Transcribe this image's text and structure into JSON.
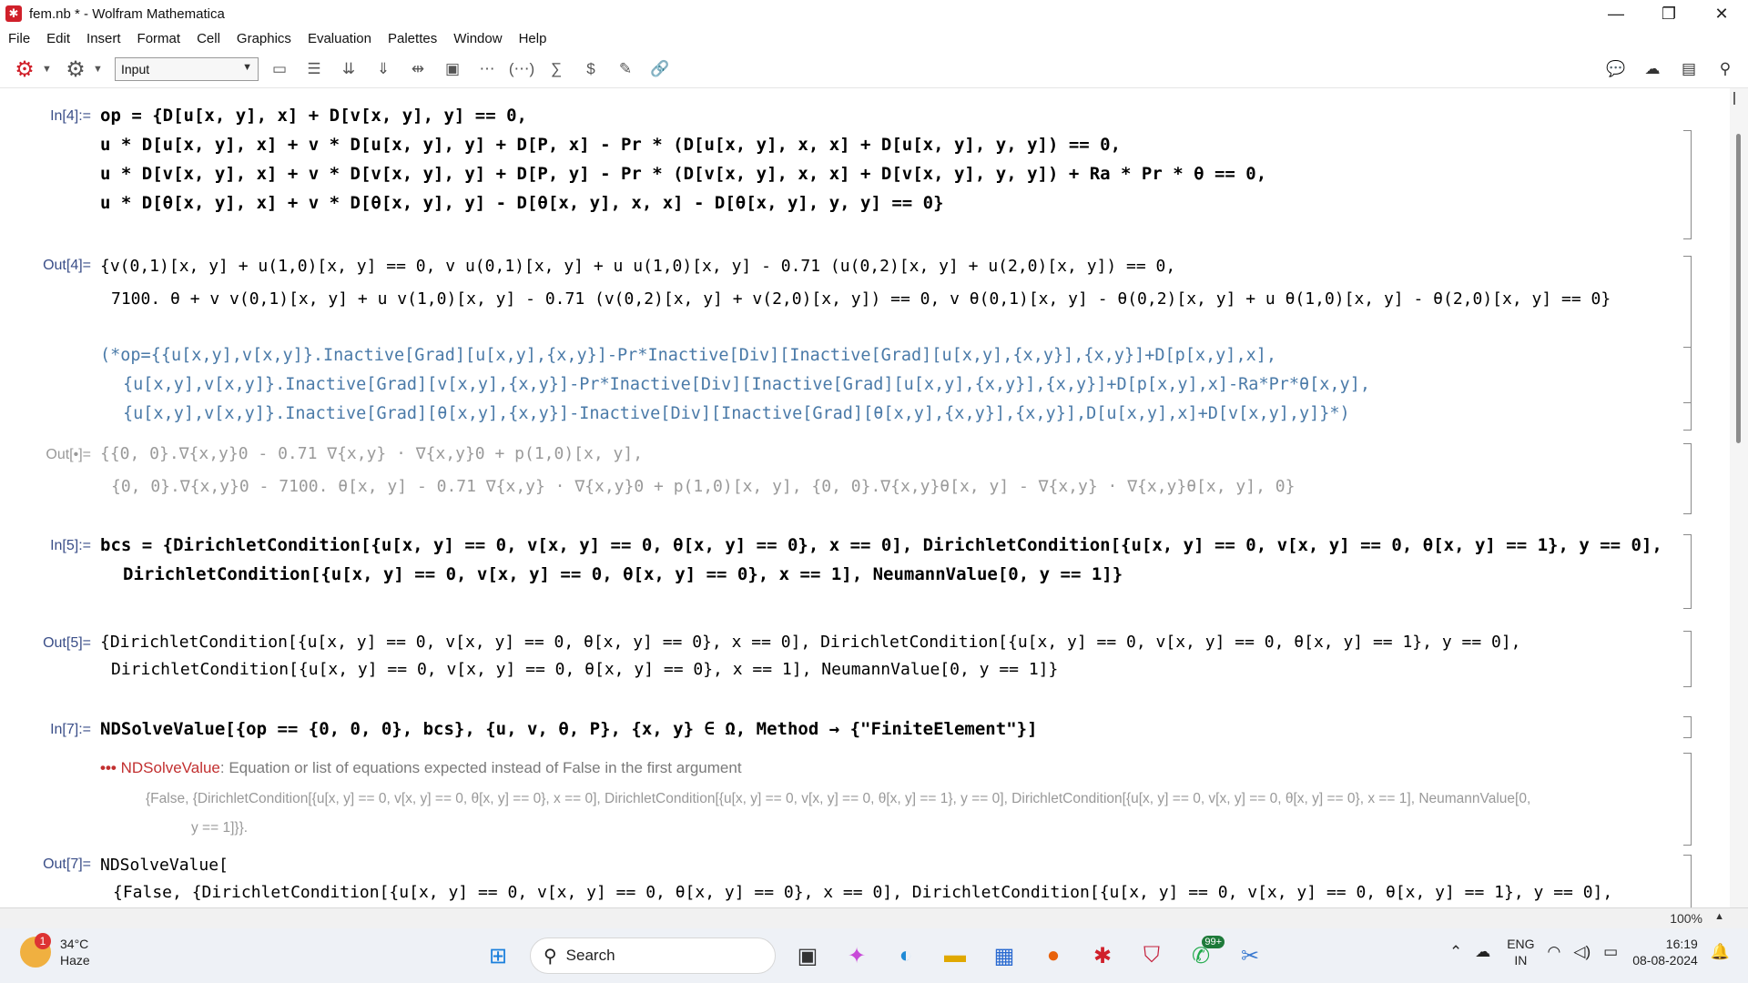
{
  "window": {
    "title": "fem.nb * - Wolfram Mathematica",
    "minimize": "—",
    "restore": "❐",
    "close": "✕"
  },
  "menu": [
    "File",
    "Edit",
    "Insert",
    "Format",
    "Cell",
    "Graphics",
    "Evaluation",
    "Palettes",
    "Window",
    "Help"
  ],
  "toolbar": {
    "style_value": "Input"
  },
  "cells": {
    "in4_label": "In[4]:=",
    "in4_lines": [
      "op = {D[u[x, y], x] + D[v[x, y], y] == 0,",
      "u * D[u[x, y], x] + v * D[u[x, y], y] + D[P, x] - Pr * (D[u[x, y], x, x] + D[u[x, y], y, y]) == 0,",
      "u * D[v[x, y], x] + v * D[v[x, y], y] + D[P, y] - Pr * (D[v[x, y], x, x] + D[v[x, y], y, y]) + Ra * Pr * θ == 0,",
      "u * D[θ[x, y], x] + v * D[θ[x, y], y] - D[θ[x, y], x, x] - D[θ[x, y], y, y] == 0}"
    ],
    "out4_label": "Out[4]=",
    "out4_lines": [
      "{v(0,1)[x, y] + u(1,0)[x, y] == 0, v u(0,1)[x, y] + u u(1,0)[x, y] - 0.71 (u(0,2)[x, y] + u(2,0)[x, y]) == 0,",
      "7100. θ + v v(0,1)[x, y] + u v(1,0)[x, y] - 0.71 (v(0,2)[x, y] + v(2,0)[x, y]) == 0, v θ(0,1)[x, y] - θ(0,2)[x, y] + u θ(1,0)[x, y] - θ(2,0)[x, y] == 0}"
    ],
    "comment_lines": [
      "(*op={{u[x,y],v[x,y]}.Inactive[Grad][u[x,y],{x,y}]-Pr*Inactive[Div][Inactive[Grad][u[x,y],{x,y}],{x,y}]+D[p[x,y],x],",
      "{u[x,y],v[x,y]}.Inactive[Grad][v[x,y],{x,y}]-Pr*Inactive[Div][Inactive[Grad][u[x,y],{x,y}],{x,y}]+D[p[x,y],x]-Ra*Pr*θ[x,y],",
      "{u[x,y],v[x,y]}.Inactive[Grad][θ[x,y],{x,y}]-Inactive[Div][Inactive[Grad][θ[x,y],{x,y}],{x,y}],D[u[x,y],x]+D[v[x,y],y]}*)"
    ],
    "outdot_label": "Out[•]=",
    "outdot_lines": [
      "{{0, 0}.∇{x,y}0 - 0.71 ∇{x,y} · ∇{x,y}0 + p(1,0)[x, y],",
      "{0, 0}.∇{x,y}0 - 7100. θ[x, y] - 0.71 ∇{x,y} · ∇{x,y}0 + p(1,0)[x, y], {0, 0}.∇{x,y}θ[x, y] - ∇{x,y} · ∇{x,y}θ[x, y], 0}"
    ],
    "in5_label": "In[5]:=",
    "in5_lines": [
      "bcs = {DirichletCondition[{u[x, y] == 0, v[x, y] == 0, θ[x, y] == 0}, x == 0], DirichletCondition[{u[x, y] == 0, v[x, y] == 0, θ[x, y] == 1}, y == 0],",
      "DirichletCondition[{u[x, y] == 0, v[x, y] == 0, θ[x, y] == 0}, x == 1], NeumannValue[0, y == 1]}"
    ],
    "out5_label": "Out[5]=",
    "out5_lines": [
      "{DirichletCondition[{u[x, y] == 0, v[x, y] == 0, θ[x, y] == 0}, x == 0], DirichletCondition[{u[x, y] == 0, v[x, y] == 0, θ[x, y] == 1}, y == 0],",
      "DirichletCondition[{u[x, y] == 0, v[x, y] == 0, θ[x, y] == 0}, x == 1], NeumannValue[0, y == 1]}"
    ],
    "in7_label": "In[7]:=",
    "in7_line": "NDSolveValue[{op == {0, 0, 0}, bcs}, {u, v, θ, P}, {x, y} ∈ Ω, Method → {\"FiniteElement\"}]",
    "msg_tag": "•••",
    "msg_fn": "NDSolveValue",
    "msg_text": ": Equation or list of equations expected instead of False in the first argument",
    "msg_detail_1": "{False, {DirichletCondition[{u[x, y] == 0, v[x, y] == 0, θ[x, y] == 0}, x == 0], DirichletCondition[{u[x, y] == 0, v[x, y] == 0, θ[x, y] == 1}, y == 0], DirichletCondition[{u[x, y] == 0, v[x, y] == 0, θ[x, y] == 0}, x == 1], NeumannValue[0,",
    "msg_detail_2": "y == 1]}}.",
    "out7_label": "Out[7]=",
    "out7_lines": [
      "NDSolveValue[",
      "{False, {DirichletCondition[{u[x, y] == 0, v[x, y] == 0, θ[x, y] == 0}, x == 0], DirichletCondition[{u[x, y] == 0, v[x, y] == 0, θ[x, y] == 1}, y == 0],"
    ]
  },
  "statusbar": {
    "zoom": "100%"
  },
  "taskbar": {
    "weather_badge": "1",
    "temperature": "34°C",
    "condition": "Haze",
    "search_placeholder": "Search",
    "whatsapp_badge": "99+",
    "lang_1": "ENG",
    "lang_2": "IN",
    "time": "16:19",
    "date": "08-08-2024"
  }
}
